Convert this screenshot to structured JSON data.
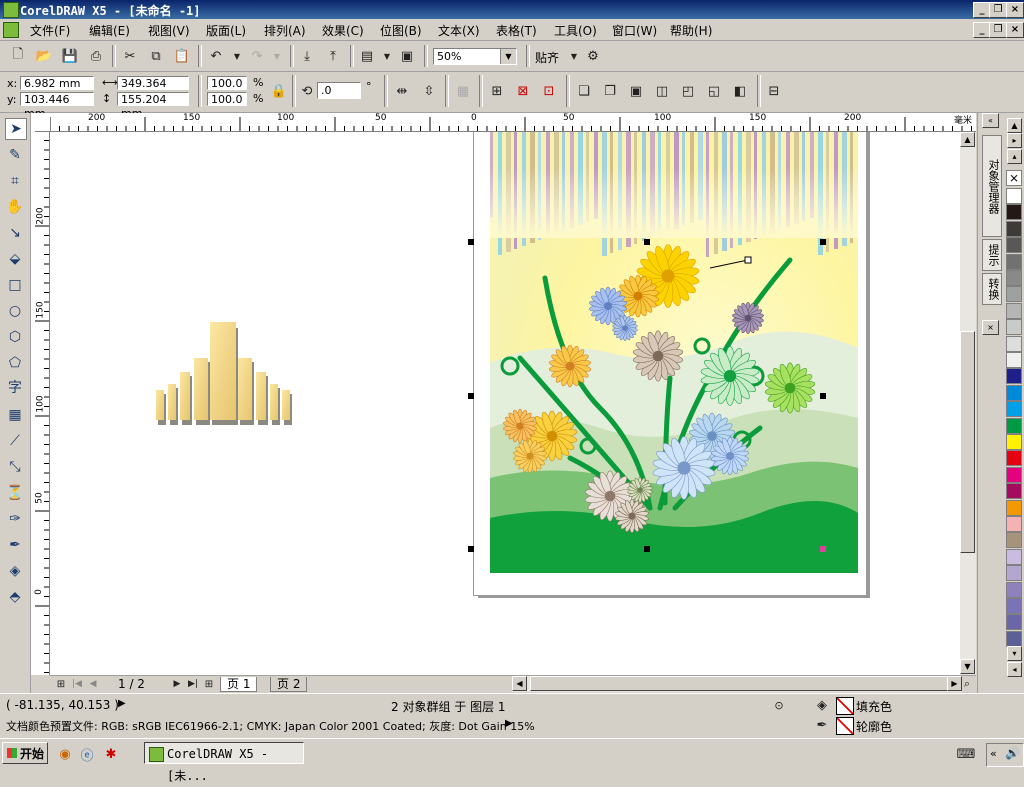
{
  "window": {
    "title": "CorelDRAW X5 - [未命名 -1]"
  },
  "menu": [
    "文件(F)",
    "编辑(E)",
    "视图(V)",
    "版面(L)",
    "排列(A)",
    "效果(C)",
    "位图(B)",
    "文本(X)",
    "表格(T)",
    "工具(O)",
    "窗口(W)",
    "帮助(H)"
  ],
  "toolbar": {
    "zoom": "50%",
    "snap_label": "贴齐"
  },
  "property_bar": {
    "x_label": "x:",
    "x_value": "6.982 mm",
    "y_label": "y:",
    "y_value": "103.446 mm",
    "width_value": "349.364 mm",
    "height_value": "155.204 mm",
    "scale_x": "100.0",
    "scale_y": "100.0",
    "percent": "%",
    "rotation": ".0",
    "degree": "°"
  },
  "ruler": {
    "h_ticks": [
      "200",
      "150",
      "100",
      "50",
      "0",
      "50",
      "100",
      "150",
      "200"
    ],
    "v_ticks": [
      "200",
      "150",
      "100",
      "50",
      "0"
    ],
    "unit": "毫米"
  },
  "docker": {
    "object_manager": "对象管理器",
    "hints": "提示",
    "transform": "转换"
  },
  "palette": [
    "#ffffff",
    "#231815",
    "#3e3a39",
    "#595757",
    "#727171",
    "#898989",
    "#9fa0a0",
    "#b5b5b6",
    "#c9caca",
    "#dcdddd",
    "#efefef",
    "#1d2088",
    "#0088d9",
    "#00a0e9",
    "#009944",
    "#fff100",
    "#e60012",
    "#e4007f",
    "#a40b5d",
    "#f39800",
    "#f5b2b2",
    "#a6937c",
    "#c9bce0",
    "#b3a6cf",
    "#8f82bc",
    "#7a73b7",
    "#6a66a8",
    "#5d6096"
  ],
  "page_nav": {
    "current": "1 / 2",
    "pages": [
      "页 1",
      "页 2"
    ]
  },
  "status": {
    "coords": "( -81.135, 40.153 )",
    "selection": "2 对象群组 于 图层 1",
    "fill_label": "填充色",
    "outline_label": "轮廓色",
    "color_profile": "文档颜色预置文件: RGB: sRGB IEC61966-2.1; CMYK: Japan Color 2001 Coated; 灰度: Dot Gain 15%"
  },
  "taskbar": {
    "start": "开始",
    "task": "CorelDRAW X5 - [未..."
  }
}
